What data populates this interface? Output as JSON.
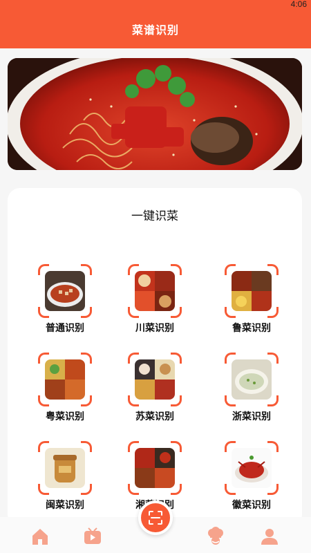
{
  "status": {
    "time": "4:06"
  },
  "header": {
    "title": "菜谱识别"
  },
  "banner": {
    "alt": "dish-photo"
  },
  "card": {
    "heading": "一键识菜",
    "items": [
      {
        "label": "普通识别",
        "icon": "mapo-tofu-photo"
      },
      {
        "label": "川菜识别",
        "icon": "sichuan-dishes-collage"
      },
      {
        "label": "鲁菜识别",
        "icon": "shandong-dishes-collage"
      },
      {
        "label": "粤菜识别",
        "icon": "cantonese-dishes-collage"
      },
      {
        "label": "苏菜识别",
        "icon": "jiangsu-dishes-collage"
      },
      {
        "label": "浙菜识别",
        "icon": "zhejiang-dish-photo"
      },
      {
        "label": "闽菜识别",
        "icon": "fujian-dish-photo"
      },
      {
        "label": "湘菜识别",
        "icon": "hunan-dishes-collage"
      },
      {
        "label": "徽菜识别",
        "icon": "anhui-dish-photo"
      }
    ]
  },
  "tabbar": {
    "tabs": [
      "home-icon",
      "video-icon",
      "scan-icon",
      "chef-icon",
      "profile-icon"
    ]
  },
  "colors": {
    "accent": "#f75a35",
    "tab_inactive": "#f6a38c"
  }
}
